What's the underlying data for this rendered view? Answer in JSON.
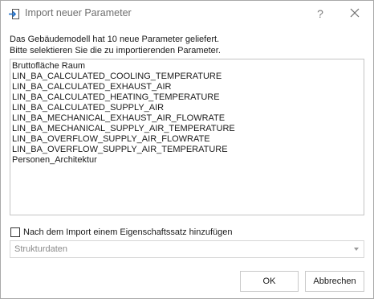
{
  "window": {
    "title": "Import neuer Parameter",
    "help_label": "?",
    "close_label": "✕"
  },
  "info": {
    "line1": "Das Gebäudemodell hat 10 neue Parameter geliefert.",
    "line2": "Bitte selektieren Sie die zu importierenden Parameter."
  },
  "parameters": [
    "Bruttofläche Raum",
    "LIN_BA_CALCULATED_COOLING_TEMPERATURE",
    "LIN_BA_CALCULATED_EXHAUST_AIR",
    "LIN_BA_CALCULATED_HEATING_TEMPERATURE",
    "LIN_BA_CALCULATED_SUPPLY_AIR",
    "LIN_BA_MECHANICAL_EXHAUST_AIR_FLOWRATE",
    "LIN_BA_MECHANICAL_SUPPLY_AIR_TEMPERATURE",
    "LIN_BA_OVERFLOW_SUPPLY_AIR_FLOWRATE",
    "LIN_BA_OVERFLOW_SUPPLY_AIR_TEMPERATURE",
    "Personen_Architektur"
  ],
  "property_set": {
    "checkbox_label": "Nach dem Import einem Eigenschaftssatz hinzufügen",
    "checked": false,
    "dropdown_value": "Strukturdaten"
  },
  "buttons": {
    "ok": "OK",
    "cancel": "Abbrechen"
  },
  "colors": {
    "accent": "#1e6fc9",
    "border": "#c4c4c4",
    "disabled_text": "#8a8a8a"
  }
}
